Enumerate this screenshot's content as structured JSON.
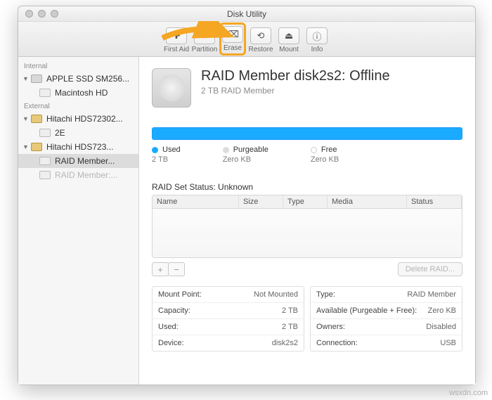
{
  "window": {
    "title": "Disk Utility"
  },
  "toolbar": {
    "first_aid": "First Aid",
    "partition": "Partition",
    "erase": "Erase",
    "restore": "Restore",
    "mount": "Mount",
    "info": "Info"
  },
  "sidebar": {
    "internal_label": "Internal",
    "external_label": "External",
    "internal": [
      {
        "name": "APPLE SSD SM256..."
      },
      {
        "name": "Macintosh HD"
      }
    ],
    "external": [
      {
        "name": "Hitachi HDS72302..."
      },
      {
        "name": "2E"
      },
      {
        "name": "Hitachi HDS723..."
      },
      {
        "name": "RAID Member..."
      },
      {
        "name": "RAID Member:..."
      }
    ]
  },
  "main": {
    "title": "RAID Member disk2s2: Offline",
    "subtitle": "2 TB RAID Member",
    "legend": {
      "used_label": "Used",
      "used_val": "2 TB",
      "purge_label": "Purgeable",
      "purge_val": "Zero KB",
      "free_label": "Free",
      "free_val": "Zero KB"
    },
    "raid_status_label": "RAID Set Status: Unknown",
    "raid_cols": {
      "name": "Name",
      "size": "Size",
      "type": "Type",
      "media": "Media",
      "status": "Status"
    },
    "add": "+",
    "remove": "−",
    "delete_raid": "Delete RAID...",
    "info_left": [
      {
        "k": "Mount Point:",
        "v": "Not Mounted"
      },
      {
        "k": "Capacity:",
        "v": "2 TB"
      },
      {
        "k": "Used:",
        "v": "2 TB"
      },
      {
        "k": "Device:",
        "v": "disk2s2"
      }
    ],
    "info_right": [
      {
        "k": "Type:",
        "v": "RAID Member"
      },
      {
        "k": "Available (Purgeable + Free):",
        "v": "Zero KB"
      },
      {
        "k": "Owners:",
        "v": "Disabled"
      },
      {
        "k": "Connection:",
        "v": "USB"
      }
    ]
  },
  "watermark": "wsxdn.com"
}
